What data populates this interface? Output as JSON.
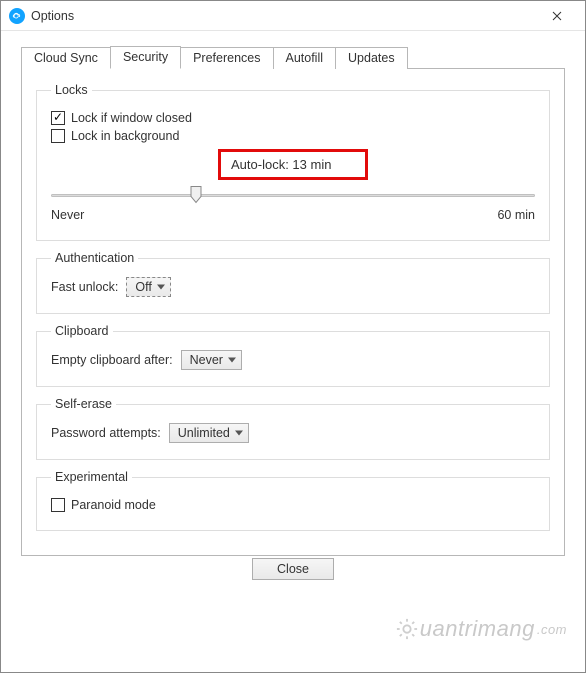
{
  "window": {
    "title": "Options"
  },
  "tabs": [
    {
      "label": "Cloud Sync",
      "active": false
    },
    {
      "label": "Security",
      "active": true
    },
    {
      "label": "Preferences",
      "active": false
    },
    {
      "label": "Autofill",
      "active": false
    },
    {
      "label": "Updates",
      "active": false
    }
  ],
  "locks": {
    "legend": "Locks",
    "lock_if_window_closed": {
      "label": "Lock if window closed",
      "checked": true
    },
    "lock_in_background": {
      "label": "Lock in background",
      "checked": false
    },
    "autolock_text": "Auto-lock: 13 min",
    "slider": {
      "min_label": "Never",
      "max_label": "60 min",
      "value_percent": 30
    }
  },
  "authentication": {
    "legend": "Authentication",
    "fast_unlock_label": "Fast unlock:",
    "fast_unlock_value": "Off"
  },
  "clipboard": {
    "legend": "Clipboard",
    "empty_after_label": "Empty clipboard after:",
    "empty_after_value": "Never"
  },
  "self_erase": {
    "legend": "Self-erase",
    "password_attempts_label": "Password attempts:",
    "password_attempts_value": "Unlimited"
  },
  "experimental": {
    "legend": "Experimental",
    "paranoid_mode": {
      "label": "Paranoid mode",
      "checked": false
    }
  },
  "footer": {
    "close_label": "Close"
  },
  "watermark": {
    "text": "uantrimang"
  }
}
